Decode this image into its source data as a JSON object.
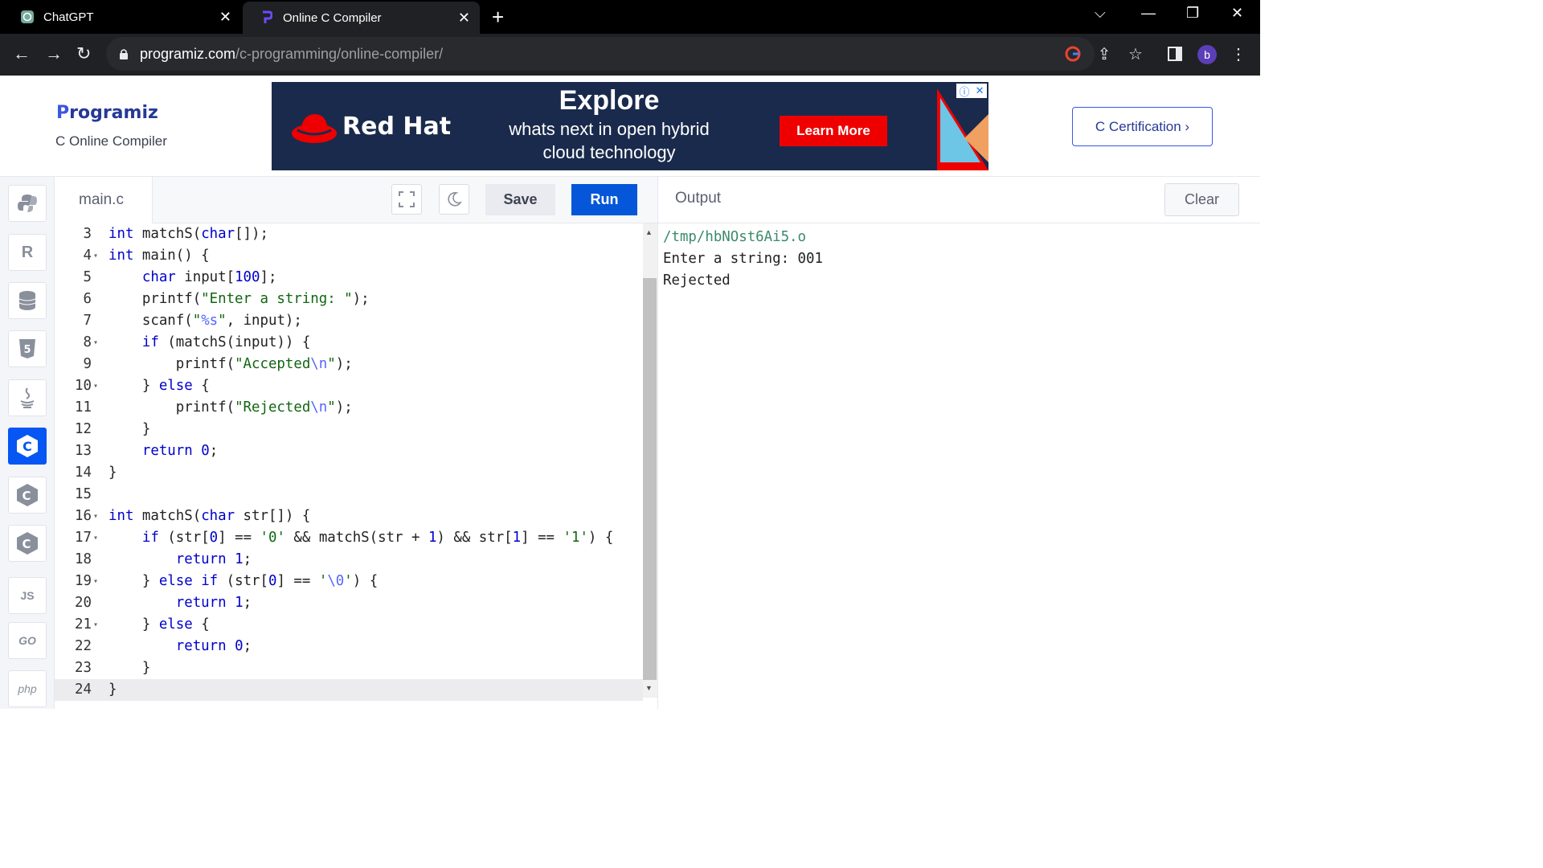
{
  "browser": {
    "tabs": [
      {
        "title": "ChatGPT",
        "active": false
      },
      {
        "title": "Online C Compiler",
        "active": true
      }
    ],
    "url_domain": "programiz.com",
    "url_path": "/c-programming/online-compiler/",
    "profile_initial": "b"
  },
  "header": {
    "logo_initial": "P",
    "logo_rest": "rogramiz",
    "subtitle": "C Online Compiler",
    "certification_button": "C Certification ›"
  },
  "ad": {
    "brand": "Red Hat",
    "headline": "Explore",
    "body_line1": "whats next in open hybrid",
    "body_line2": "cloud technology",
    "cta": "Learn More"
  },
  "sidebar": {
    "languages": [
      {
        "name": "python",
        "label": "",
        "active": false
      },
      {
        "name": "r",
        "label": "R",
        "active": false
      },
      {
        "name": "sql",
        "label": "",
        "active": false
      },
      {
        "name": "html",
        "label": "5",
        "active": false
      },
      {
        "name": "java",
        "label": "",
        "active": false
      },
      {
        "name": "c",
        "label": "C",
        "active": true
      },
      {
        "name": "cpp",
        "label": "C",
        "active": false
      },
      {
        "name": "csharp",
        "label": "C",
        "active": false
      },
      {
        "name": "js",
        "label": "JS",
        "active": false
      },
      {
        "name": "go",
        "label": "GO",
        "active": false
      },
      {
        "name": "php",
        "label": "php",
        "active": false
      }
    ]
  },
  "editor": {
    "filename": "main.c",
    "save_label": "Save",
    "run_label": "Run",
    "lines": [
      {
        "n": "3",
        "fold": false,
        "code": "int matchS(char[]);"
      },
      {
        "n": "4",
        "fold": true,
        "code": "int main() {"
      },
      {
        "n": "5",
        "fold": false,
        "code": "    char input[100];"
      },
      {
        "n": "6",
        "fold": false,
        "code": "    printf(\"Enter a string: \");"
      },
      {
        "n": "7",
        "fold": false,
        "code": "    scanf(\"%s\", input);"
      },
      {
        "n": "8",
        "fold": true,
        "code": "    if (matchS(input)) {"
      },
      {
        "n": "9",
        "fold": false,
        "code": "        printf(\"Accepted\\n\");"
      },
      {
        "n": "10",
        "fold": true,
        "code": "    } else {"
      },
      {
        "n": "11",
        "fold": false,
        "code": "        printf(\"Rejected\\n\");"
      },
      {
        "n": "12",
        "fold": false,
        "code": "    }"
      },
      {
        "n": "13",
        "fold": false,
        "code": "    return 0;"
      },
      {
        "n": "14",
        "fold": false,
        "code": "}"
      },
      {
        "n": "15",
        "fold": false,
        "code": ""
      },
      {
        "n": "16",
        "fold": true,
        "code": "int matchS(char str[]) {"
      },
      {
        "n": "17",
        "fold": true,
        "code": "    if (str[0] == '0' && matchS(str + 1) && str[1] == '1') {"
      },
      {
        "n": "18",
        "fold": false,
        "code": "        return 1;"
      },
      {
        "n": "19",
        "fold": true,
        "code": "    } else if (str[0] == '\\0') {"
      },
      {
        "n": "20",
        "fold": false,
        "code": "        return 1;"
      },
      {
        "n": "21",
        "fold": true,
        "code": "    } else {"
      },
      {
        "n": "22",
        "fold": false,
        "code": "        return 0;"
      },
      {
        "n": "23",
        "fold": false,
        "code": "    }"
      },
      {
        "n": "24",
        "fold": false,
        "code": "}"
      }
    ],
    "current_line": "24"
  },
  "output": {
    "title": "Output",
    "clear_label": "Clear",
    "lines": [
      "/tmp/hbNOst6Ai5.o",
      "Enter a string: 001",
      "Rejected"
    ]
  },
  "colors": {
    "accent": "#0556d8",
    "tab_bar": "#000000",
    "address_bar": "#202124"
  }
}
